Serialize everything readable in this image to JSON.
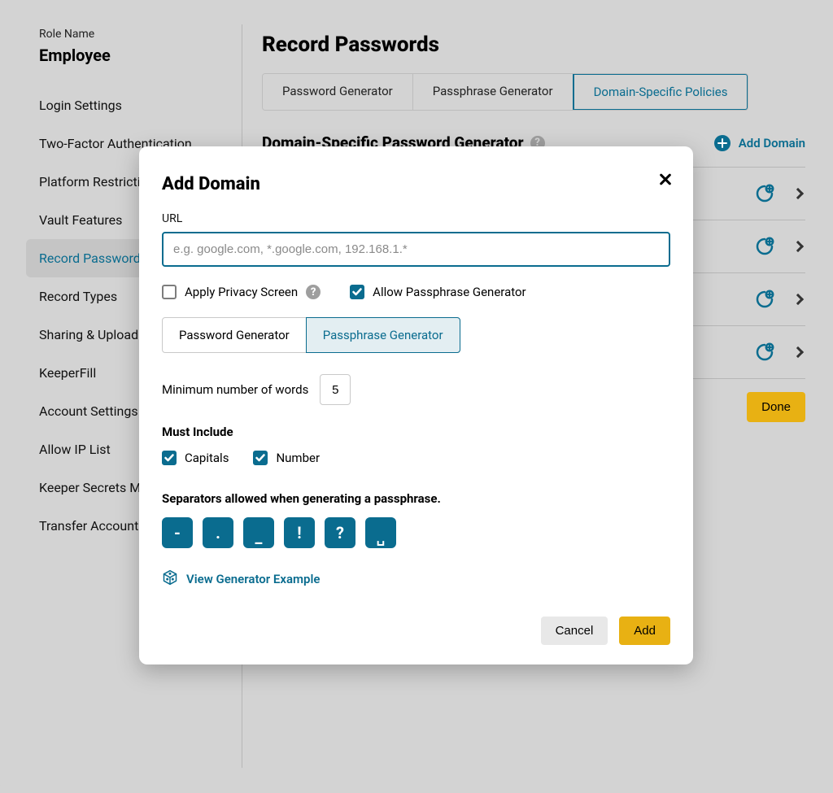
{
  "sidebar": {
    "role_label": "Role Name",
    "role_value": "Employee",
    "items": [
      {
        "label": "Login Settings"
      },
      {
        "label": "Two-Factor Authentication"
      },
      {
        "label": "Platform Restriction"
      },
      {
        "label": "Vault Features"
      },
      {
        "label": "Record Passwords",
        "active": true
      },
      {
        "label": "Record Types"
      },
      {
        "label": "Sharing & Uploading"
      },
      {
        "label": "KeeperFill"
      },
      {
        "label": "Account Settings"
      },
      {
        "label": "Allow IP List"
      },
      {
        "label": "Keeper Secrets Manager"
      },
      {
        "label": "Transfer Account"
      }
    ]
  },
  "main": {
    "title": "Record Passwords",
    "tabs": [
      {
        "label": "Password Generator"
      },
      {
        "label": "Passphrase Generator"
      },
      {
        "label": "Domain-Specific Policies",
        "active": true
      }
    ],
    "section_title": "Domain-Specific Password Generator",
    "add_domain_label": "Add Domain",
    "done_label": "Done",
    "domain_rows": 4
  },
  "modal": {
    "title": "Add Domain",
    "url_label": "URL",
    "url_placeholder": "e.g. google.com, *.google.com, 192.168.1.*",
    "apply_privacy_label": "Apply Privacy Screen",
    "allow_passphrase_label": "Allow Passphrase Generator",
    "gen_tabs": [
      {
        "label": "Password Generator"
      },
      {
        "label": "Passphrase Generator",
        "active": true
      }
    ],
    "min_words_label": "Minimum number of words",
    "min_words_value": "5",
    "must_include_label": "Must Include",
    "capitals_label": "Capitals",
    "number_label": "Number",
    "sep_label": "Separators allowed when generating a passphrase.",
    "separators": [
      "-",
      ".",
      "_",
      "!",
      "?",
      "␣"
    ],
    "view_example_label": "View Generator Example",
    "cancel_label": "Cancel",
    "add_label": "Add"
  }
}
